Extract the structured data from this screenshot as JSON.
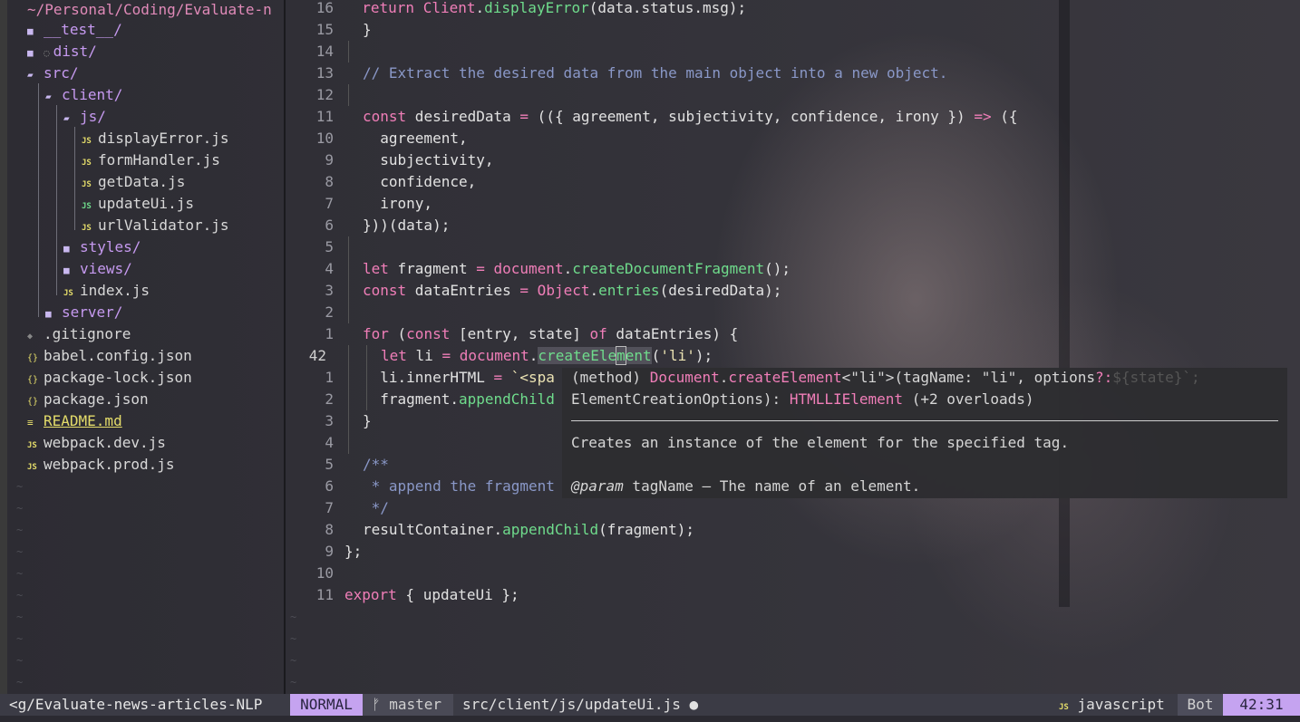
{
  "tree": {
    "header": "~/Personal/Coding/Evaluate-n",
    "items": [
      {
        "name": "__test__/",
        "kind": "dir"
      },
      {
        "name": "dist/",
        "kind": "dir",
        "note": "◌"
      },
      {
        "name": "src/",
        "kind": "dir-open"
      },
      {
        "name": "client/",
        "kind": "dir-open"
      },
      {
        "name": "js/",
        "kind": "dir-open"
      },
      {
        "name": "displayError.js",
        "kind": "js"
      },
      {
        "name": "formHandler.js",
        "kind": "js"
      },
      {
        "name": "getData.js",
        "kind": "js"
      },
      {
        "name": "updateUi.js",
        "kind": "js"
      },
      {
        "name": "urlValidator.js",
        "kind": "js"
      },
      {
        "name": "styles/",
        "kind": "dir"
      },
      {
        "name": "views/",
        "kind": "dir"
      },
      {
        "name": "index.js",
        "kind": "js"
      },
      {
        "name": "server/",
        "kind": "dir"
      },
      {
        "name": ".gitignore",
        "kind": "git"
      },
      {
        "name": "babel.config.json",
        "kind": "json"
      },
      {
        "name": "package-lock.json",
        "kind": "json"
      },
      {
        "name": "package.json",
        "kind": "json"
      },
      {
        "name": "README.md",
        "kind": "md"
      },
      {
        "name": "webpack.dev.js",
        "kind": "js"
      },
      {
        "name": "webpack.prod.js",
        "kind": "js"
      }
    ],
    "icons": {
      "dir": "folder-icon",
      "js": "JS",
      "json": "{}",
      "md": "≡",
      "git": "◆"
    }
  },
  "editor": {
    "line_numbers": [
      "16",
      "15",
      "14",
      "13",
      "12",
      "11",
      "10",
      "9",
      "8",
      "7",
      "6",
      "5",
      "4",
      "3",
      "2",
      "1",
      "42",
      "1",
      "2",
      "3",
      "4",
      "5",
      "6",
      "7",
      "8",
      "9",
      "10",
      "11"
    ],
    "current_line": "42",
    "lines": {
      "l0": {
        "a": "  return ",
        "b": "Client",
        ".c": "",
        "c": ".",
        "d": "displayError",
        "e": "(data.status.msg);"
      },
      "l1": "}",
      "l3": "// Extract the desired data from the main object into a new object.",
      "l5": {
        "a": "const",
        "b": " desiredData ",
        "c": "=",
        "d": " (({ agreement, subjectivity, confidence, irony }) ",
        "e": "=>",
        "f": " ({"
      },
      "l6": "  agreement,",
      "l7": "  subjectivity,",
      "l8": "  confidence,",
      "l9": "  irony,",
      "l10": "}))(data);",
      "l12": {
        "a": "let",
        "b": " fragment ",
        "c": "=",
        "d": " document",
        "e": ".",
        "f": "createDocumentFragment",
        "g": "();"
      },
      "l13": {
        "a": "const",
        "b": " dataEntries ",
        "c": "=",
        "d": " Object",
        "e": ".",
        "f": "entries",
        "g": "(desiredData);"
      },
      "l15": {
        "a": "for",
        "b": " (",
        "c": "const",
        "d": " [entry, state] ",
        "e": "of",
        "f": " dataEntries) {"
      },
      "l16": {
        "a": "let",
        "b": " li ",
        "c": "=",
        "d": " document",
        "e": ".",
        "f": "createEle",
        "g": "m",
        "h": "ent",
        "i": "(",
        "j": "'li'",
        "k": ");"
      },
      "l17": {
        "a": "  li.innerHTML ",
        "b": "=",
        "c": " `<spa"
      },
      "l18": {
        "a": "  fragment.",
        "b": "appendChild"
      },
      "l19": "}",
      "l21": "/**",
      "l22": " * append the fragment",
      "l23": " */",
      "l24": {
        "a": "resultContainer.",
        "b": "appendChild",
        "c": "(fragment);"
      },
      "l25": "};",
      "l27": {
        "a": "export",
        "b": " { updateUi };"
      }
    }
  },
  "popup": {
    "line1": {
      "a": "(method) ",
      "b": "Document",
      "c": ".",
      "d": "createElement",
      "e": "<\"li\">(tagName: \"li\", options",
      "f": "?:"
    },
    "line2": {
      "a": "ElementCreationOptions): ",
      "b": "HTMLLIElement",
      "c": " (+2 overloads)"
    },
    "doc": "Creates an instance of the element for the specified tag.",
    "param_tag": "@param",
    "param_text": " tagName — The name of an element.",
    "ghost": "${state}`;"
  },
  "status": {
    "left_path": "<g/Evaluate-news-articles-NLP",
    "mode": "NORMAL",
    "branch_icon": "ᚠ",
    "branch": "master",
    "file": "src/client/js/updateUi.js",
    "modified": "●",
    "filetype_icon": "JS",
    "filetype": "javascript",
    "position_label": "Bot",
    "cursor": "42:31",
    "colors": {
      "mode_bg": "#c5a3f0",
      "branch_bg": "#4a4a56",
      "bot_bg": "#4d4d5b",
      "pos_bg": "#c5a3f0"
    }
  }
}
